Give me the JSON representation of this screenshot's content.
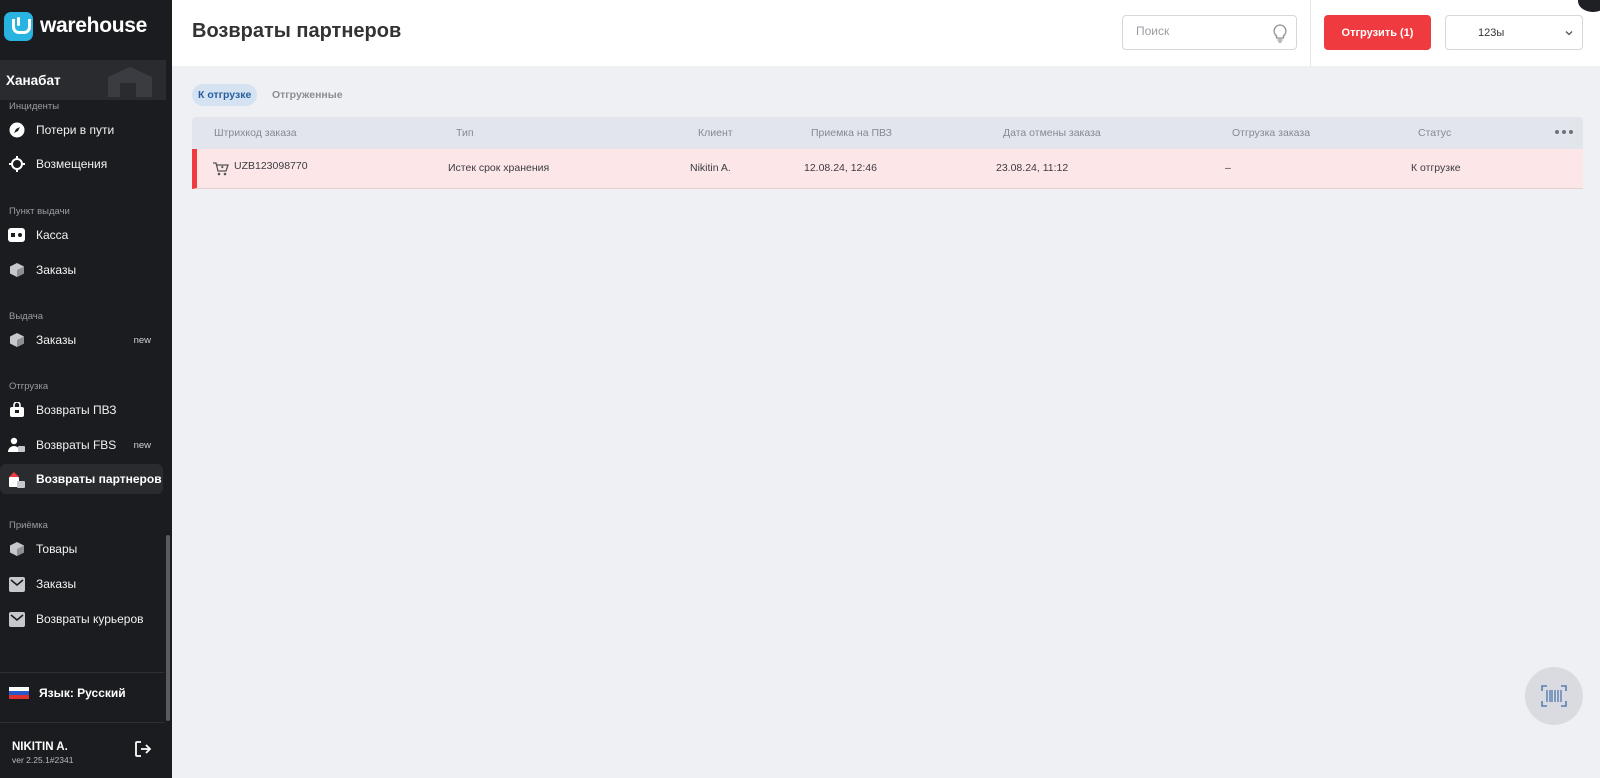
{
  "app": {
    "logo_text": "warehouse"
  },
  "store": {
    "name": "Ханабат"
  },
  "sidebar": {
    "sections": {
      "incidents": "Инциденты",
      "pickup_point": "Пункт выдачи",
      "issuance": "Выдача",
      "shipment": "Отгрузка",
      "receiving": "Приёмка"
    },
    "items": [
      {
        "label": "Потери в пути",
        "icon": "compass-icon"
      },
      {
        "label": "Возмещения",
        "icon": "target-icon"
      },
      {
        "label": "Касса",
        "icon": "cash-register-icon"
      },
      {
        "label": "Заказы",
        "icon": "box-icon"
      },
      {
        "label": "Заказы",
        "icon": "box-icon",
        "badge": "new"
      },
      {
        "label": "Возвраты ПВЗ",
        "icon": "return-bag-icon"
      },
      {
        "label": "Возвраты FBS",
        "icon": "person-box-icon",
        "badge": "new"
      },
      {
        "label": "Возвраты партнеров",
        "icon": "partner-return-icon",
        "active": true
      },
      {
        "label": "Товары",
        "icon": "box-icon"
      },
      {
        "label": "Заказы",
        "icon": "envelope-box-icon"
      },
      {
        "label": "Возвраты курьеров",
        "icon": "envelope-box-icon"
      }
    ],
    "language": "Язык: Русский",
    "user": {
      "name": "NIKITIN A.",
      "version": "ver 2.25.1#2341"
    }
  },
  "header": {
    "title": "Возвраты партнеров",
    "search_placeholder": "Поиск",
    "ship_button": "Отгрузить (1)",
    "select_value": "123ы"
  },
  "tabs": [
    {
      "label": "К отгрузке",
      "active": true
    },
    {
      "label": "Отгруженные",
      "active": false
    }
  ],
  "table": {
    "columns": [
      "Штрихкод заказа",
      "Тип",
      "Клиент",
      "Приемка на ПВЗ",
      "Дата отмены заказа",
      "Отгрузка заказа",
      "Статус"
    ],
    "rows": [
      {
        "barcode": "UZB123098770",
        "type": "Истек срок хранения",
        "client": "Nikitin A.",
        "received": "12.08.24, 12:46",
        "cancelled": "23.08.24, 11:12",
        "shipped": "–",
        "status": "К отгрузке"
      }
    ]
  },
  "colors": {
    "sidebar_bg": "#1b1c1f",
    "accent_red": "#ef3b3f",
    "logo_blue": "#29b3e1",
    "row_highlight": "#fde6e7",
    "tab_active_bg": "#d4e2f2"
  }
}
